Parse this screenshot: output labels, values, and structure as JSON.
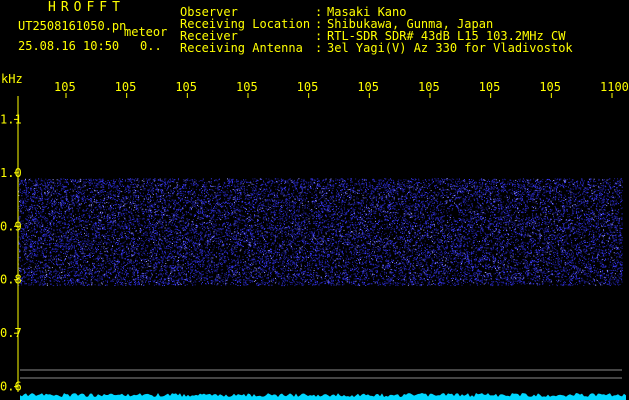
{
  "header": {
    "app_title": "HROFFT",
    "file_name": "UT2508161050.pn",
    "file_kind": "meteor",
    "date_time": "25.08.16 10:50",
    "tail_text": "0..",
    "fields": [
      {
        "label": "Observer",
        "value": "Masaki Kano"
      },
      {
        "label": "Receiving Location",
        "value": "Shibukawa, Gunma, Japan"
      },
      {
        "label": "Receiver",
        "value": "RTL-SDR SDR# 43dB L15 103.2MHz CW"
      },
      {
        "label": "Receiving Antenna",
        "value": "3el Yagi(V) Az 330 for Vladivostok"
      }
    ],
    "separator": ":"
  },
  "chart_data": {
    "type": "heatmap",
    "ylabel": "kHz",
    "x_tick_labels": [
      "105",
      "105",
      "105",
      "105",
      "105",
      "105",
      "105",
      "105",
      "105",
      "1100"
    ],
    "y_ticks": [
      {
        "value": 1.1,
        "label": "1.1"
      },
      {
        "value": 1.0,
        "label": "1.0"
      },
      {
        "value": 0.9,
        "label": "0.9"
      },
      {
        "value": 0.8,
        "label": "0.8"
      },
      {
        "value": 0.7,
        "label": "0.7"
      },
      {
        "value": 0.6,
        "label": "0.6"
      }
    ],
    "ylim": [
      0.59,
      1.14
    ],
    "signal_band_khz": [
      0.79,
      0.99
    ],
    "colors": {
      "signal": "#3a3aff",
      "axis": "#ffff00",
      "baseline": "#00d8ff",
      "reference_line": "#8a8a8a"
    }
  }
}
